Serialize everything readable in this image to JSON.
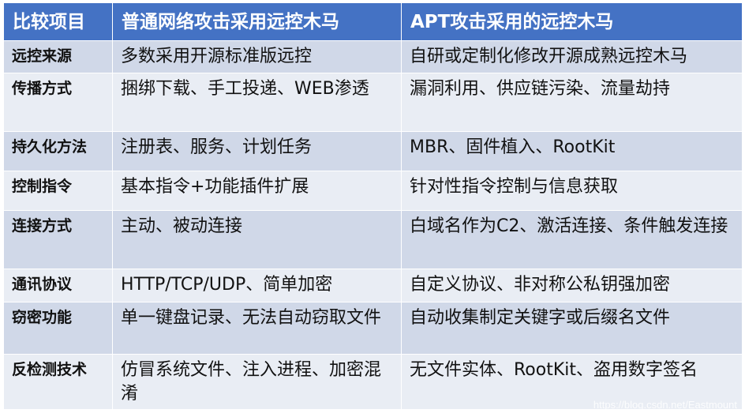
{
  "table": {
    "headers": [
      "比较项目",
      "普通网络攻击采用远控木马",
      "APT攻击采用的远控木马"
    ],
    "rows": [
      [
        "远控来源",
        "多数采用开源标准版远控",
        "自研或定制化修改开源成熟远控木马"
      ],
      [
        "传播方式",
        "捆绑下载、手工投递、WEB渗透",
        "漏洞利用、供应链污染、流量劫持"
      ],
      [
        "持久化方法",
        "注册表、服务、计划任务",
        "MBR、固件植入、RootKit"
      ],
      [
        "控制指令",
        "基本指令+功能插件扩展",
        "针对性指令控制与信息获取"
      ],
      [
        "连接方式",
        "主动、被动连接",
        "白域名作为C2、激活连接、条件触发连接"
      ],
      [
        "通讯协议",
        "HTTP/TCP/UDP、简单加密",
        "自定义协议、非对称公私钥强加密"
      ],
      [
        "窃密功能",
        "单一键盘记录、无法自动窃取文件",
        "自动收集制定关键字或后缀名文件"
      ],
      [
        "反检测技术",
        "仿冒系统文件、注入进程、加密混淆",
        "无文件实体、RootKit、盗用数字签名"
      ]
    ]
  },
  "watermark": "https://blog.csdn.net/Eastmount",
  "colors": {
    "header": "#4472c4",
    "row_odd": "#d0d8e8",
    "row_even": "#e9edf4"
  }
}
